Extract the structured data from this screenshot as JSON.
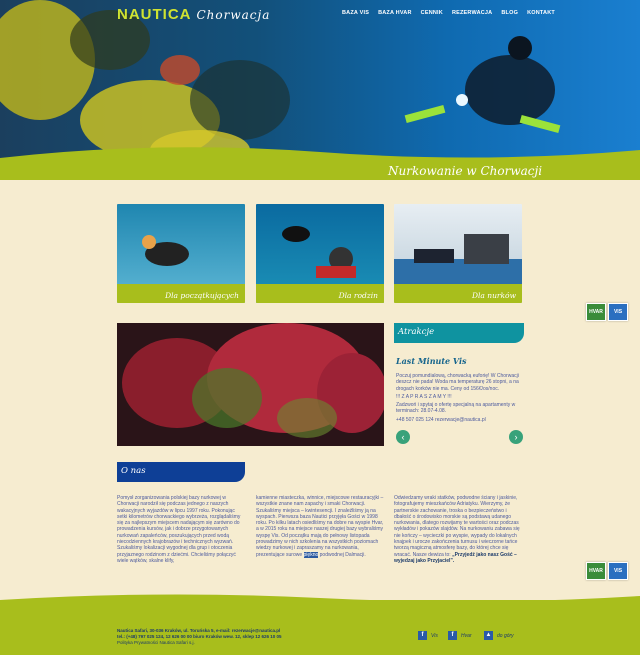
{
  "header": {
    "logo_main": "NAUTICA",
    "logo_sub": "Chorwacja",
    "nav": [
      "BAZA VIS",
      "BAZA HVAR",
      "CENNIK",
      "REZERWACJA",
      "BLOG",
      "KONTAKT"
    ],
    "hero_title": "Nurkowanie w Chorwacji"
  },
  "cards": [
    {
      "label": "Dla początkujących"
    },
    {
      "label": "Dla rodzin"
    },
    {
      "label": "Dla nurków"
    }
  ],
  "side_badges": {
    "top": [
      "HVAR",
      "VIS"
    ],
    "bottom": [
      "HVAR",
      "VIS"
    ]
  },
  "attractions": {
    "heading": "Atrakcje",
    "title": "Last Minute Vis",
    "lines": [
      "Poczuj pomundialową, chorwacką euforię! W Chorwacji deszcz nie pada! Woda ma temperaturę 26 stopni, a na drogach korków nie ma. Ceny od 156€/os/noc.",
      "!!! Z A P R A S Z A M Y !!!",
      "Zadzwoń i spytaj o ofertę specjalną na apartamenty w terminach: 28.07-4.08.",
      "+48 507 025 124 rezerwacje@nautica.pl"
    ],
    "prev": "‹",
    "next": "›"
  },
  "about": {
    "heading": "O nas",
    "col1": "Pomysł zorganizowania polskiej bazy nurkowej w Chorwacji narodził się podczas jednego z naszych wakacyjnych wyjazdów w lipcu 1997 roku. Pokonując setki kilometrów chorwackiego wybrzeża, rozglądaliśmy się za najlepszym miejscem nadającym się zarówno do prowadzenia kursów, jak i dobrze przygotowanych nurkowań zapaleńców, poszukujących przed wodą niecodziennych krajobrazów i technicznych wyzwań. Szukaliśmy lokalizacji wygodnej dla grup i otoczenia przyjaznego rodzinom z dziećmi. Chcieliśmy połączyć wiele wątków, skalne klify,",
    "col2_before": "kamienne miasteczka, winnice, miejscowe restauracyjki – wszystkie znane nam zapachy i smaki Chorwacji. Szukaliśmy miejsca – kwintesencji. I znaleźliśmy ją na wyspach. Pierwsza baza Nautici przyjęła Gości w 1998 roku. Po kilku latach osiedliśmy na dobre na wyspie Hvar, a w 2015 roku na miejsce naszej drugiej bazy wybraliśmy wyspę Vis. Od początku mają do pełnowy listopada prowadzimy w nich szkolenia na wszystkich poziomach wiedzy nurkowej i zapraszamy na nurkowania, prezentujące surowe",
    "col2_highlight": "piękno",
    "col2_after": "podwodnej Dalmacji.",
    "col3": "Odwiedzamy wraki statków, podwodne ściany i jaskinie, fotografujemy mieszkańców Adriatyku. Wierzymy, że partnerskie zachowanie, troska o bezpieczeństwo i dbałość o środowisko morskie są podstawą udanego nurkowania, dlatego rozwijamy te wartości oraz podczas wykładów i pokazów slajdów. Na nurkowaniu zabawa się nie kończy – wycieczki po wyspie, wypady do lokalnych knajpek i urocze zakończenia turnusu i wieczorne tańce tworzą magiczną atmosferę bazy, do której chce się wracać. Nasze dewiza to:",
    "col3_bold": "„Przyjedź jako nasz Gość – wyjedzaj jako Przyjaciel”."
  },
  "footer": {
    "line1": "Nautica Safari, 30-036 Kraków, ul. Toruńska 5, e-mail: rezerwacje@nautica.pl",
    "line2": "tel.: (+48) 797 025 124, 12 626 00 00 biuro Kraków wew. 12, sklep 12 626 10 05",
    "line3": "Polityka Prywatności Nautica Safari s.j.",
    "social": [
      "Vis",
      "Hvar",
      "do góry"
    ]
  },
  "colors": {
    "accent_green": "#a8be1c",
    "teal": "#0f93a0",
    "navy": "#0e3f96",
    "page_bg": "#f6ecd0"
  }
}
